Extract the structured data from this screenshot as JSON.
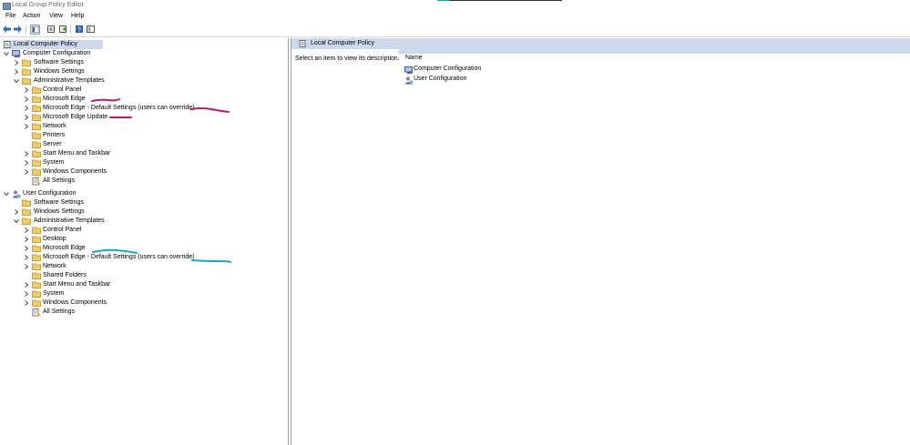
{
  "window": {
    "title": "Local Group Policy Editor"
  },
  "menu": [
    "File",
    "Action",
    "View",
    "Help"
  ],
  "toolbar_icons": [
    "back-arrow-icon",
    "forward-arrow-icon",
    "show-hide-console-tree-icon",
    "properties-icon",
    "export-list-icon",
    "help-icon",
    "extended-view-icon"
  ],
  "tree": {
    "root": "Local Computer Policy",
    "computer": {
      "label": "Computer Configuration",
      "software": "Software Settings",
      "windows": "Windows Settings",
      "admin": "Administrative Templates",
      "items": [
        "Control Panel",
        "Microsoft Edge",
        "Microsoft Edge - Default Settings (users can override)",
        "Microsoft Edge Update",
        "Network",
        "Printers",
        "Server",
        "Start Menu and Taskbar",
        "System",
        "Windows Components",
        "All Settings"
      ]
    },
    "user": {
      "label": "User Configuration",
      "software": "Software Settings",
      "windows": "Windows Settings",
      "admin": "Administrative Templates",
      "items": [
        "Control Panel",
        "Desktop",
        "Microsoft Edge",
        "Microsoft Edge - Default Settings (users can override)",
        "Network",
        "Shared Folders",
        "Start Menu and Taskbar",
        "System",
        "Windows Components",
        "All Settings"
      ]
    }
  },
  "right": {
    "header": "Local Computer Policy",
    "description": "Select an item to view its description.",
    "column_name": "Name",
    "items": [
      "Computer Configuration",
      "User Configuration"
    ]
  },
  "colors": {
    "selection": "#ccd9ea",
    "folder": "#f0cc6a",
    "annotation_magenta": "#a8246e",
    "annotation_blue": "#1aa3c8"
  }
}
